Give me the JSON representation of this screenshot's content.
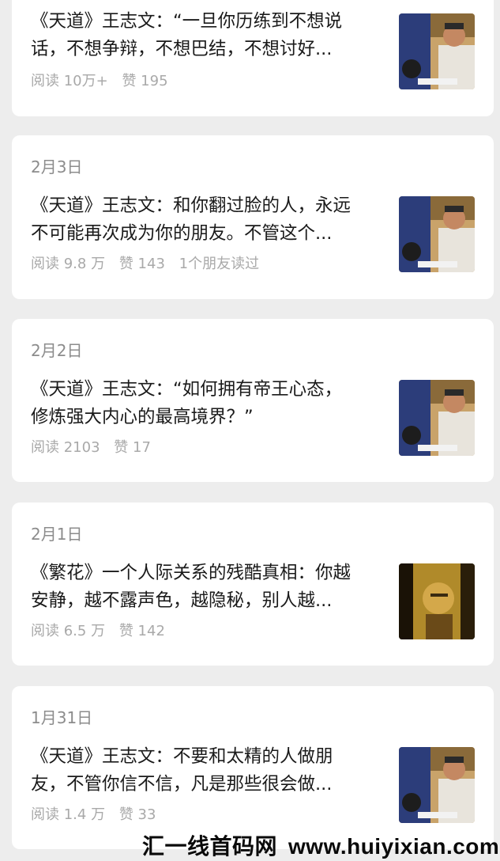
{
  "articles": [
    {
      "date": "",
      "title_line1": "《天道》王志文：“一旦你历练到不想说",
      "title_line2": "话，不想争辩，不想巴结，不想讨好...",
      "reads": "阅读 10万+",
      "likes": "赞 195",
      "friends": "",
      "thumb_icon": "man-playing-chess-photo"
    },
    {
      "date": "2月3日",
      "title_line1": "《天道》王志文：和你翻过脸的人，永远",
      "title_line2": "不可能再次成为你的朋友。不管这个...",
      "reads": "阅读 9.8 万",
      "likes": "赞 143",
      "friends": "1个朋友读过",
      "thumb_icon": "man-playing-chess-photo"
    },
    {
      "date": "2月2日",
      "title_line1": "《天道》王志文：“如何拥有帝王心态，",
      "title_line2": "修炼强大内心的最高境界？”",
      "reads": "阅读 2103",
      "likes": "赞 17",
      "friends": "",
      "thumb_icon": "man-playing-chess-photo"
    },
    {
      "date": "2月1日",
      "title_line1": "《繁花》一个人际关系的残酷真相：你越",
      "title_line2": "安静，越不露声色，越隐秘，别人越...",
      "reads": "阅读 6.5 万",
      "likes": "赞 142",
      "friends": "",
      "thumb_icon": "man-portrait-golden-light-photo"
    },
    {
      "date": "1月31日",
      "title_line1": "《天道》王志文：不要和太精的人做朋",
      "title_line2": "友，不管你信不信，凡是那些很会做...",
      "reads": "阅读 1.4 万",
      "likes": "赞 33",
      "friends": "",
      "thumb_icon": "man-playing-chess-photo"
    }
  ],
  "watermark": {
    "cn": "汇一线首码网",
    "url": "www.huiyixian.com"
  }
}
